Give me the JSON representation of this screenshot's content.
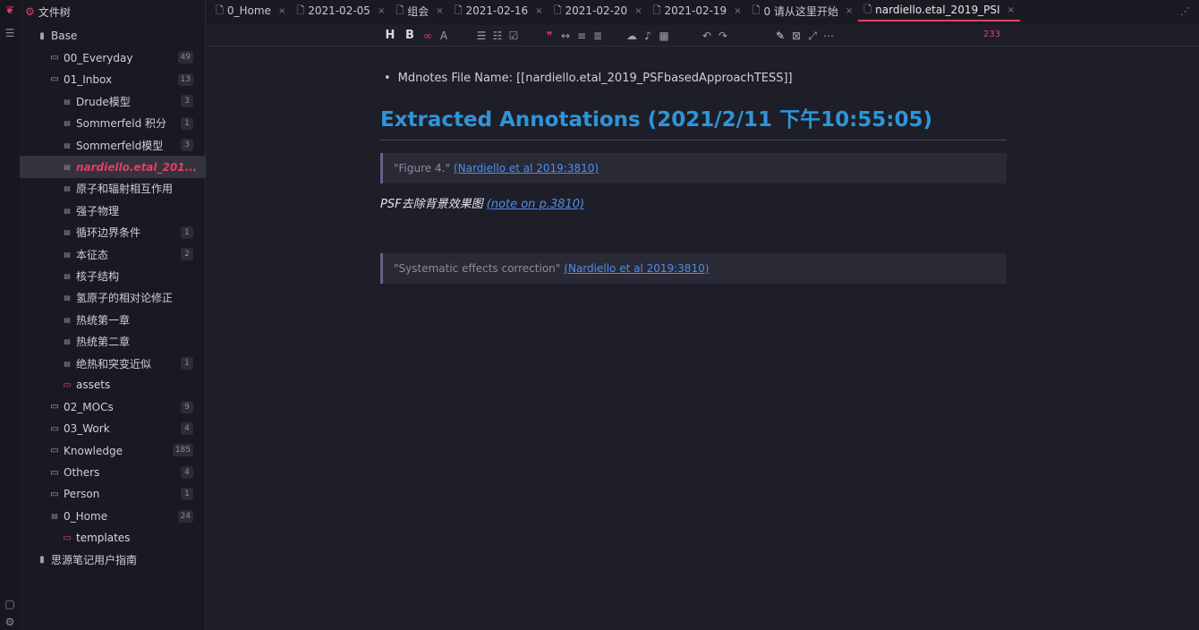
{
  "sidebar": {
    "title": "文件树",
    "items": [
      {
        "label": "Base",
        "icon": "book-icon",
        "count": ""
      },
      {
        "label": "00_Everyday",
        "icon": "folder-icon",
        "count": "49"
      },
      {
        "label": "01_Inbox",
        "icon": "folder-icon",
        "count": "13"
      },
      {
        "label": "Drude模型",
        "icon": "file-icon",
        "count": "3"
      },
      {
        "label": "Sommerfeld 积分",
        "icon": "file-icon",
        "count": "1"
      },
      {
        "label": "Sommerfeld模型",
        "icon": "file-icon",
        "count": "3"
      },
      {
        "label": "nardiello.etal_201...",
        "icon": "file-icon",
        "count": ""
      },
      {
        "label": "原子和辐射相互作用",
        "icon": "file-icon",
        "count": ""
      },
      {
        "label": "强子物理",
        "icon": "file-icon",
        "count": ""
      },
      {
        "label": "循环边界条件",
        "icon": "file-icon",
        "count": "1"
      },
      {
        "label": "本征态",
        "icon": "file-icon",
        "count": "2"
      },
      {
        "label": "核子结构",
        "icon": "file-icon",
        "count": ""
      },
      {
        "label": "氢原子的相对论修正",
        "icon": "file-icon",
        "count": ""
      },
      {
        "label": "热统第一章",
        "icon": "file-icon",
        "count": ""
      },
      {
        "label": "热统第二章",
        "icon": "file-icon",
        "count": ""
      },
      {
        "label": "绝热和突变近似",
        "icon": "file-icon",
        "count": "1"
      },
      {
        "label": "assets",
        "icon": "folder-icon",
        "count": ""
      },
      {
        "label": "02_MOCs",
        "icon": "folder-icon",
        "count": "9"
      },
      {
        "label": "03_Work",
        "icon": "folder-icon",
        "count": "4"
      },
      {
        "label": "Knowledge",
        "icon": "folder-icon",
        "count": "185"
      },
      {
        "label": "Others",
        "icon": "folder-icon",
        "count": "4"
      },
      {
        "label": "Person",
        "icon": "folder-icon",
        "count": "1"
      },
      {
        "label": "0_Home",
        "icon": "file-icon",
        "count": "24"
      },
      {
        "label": "templates",
        "icon": "folder-icon",
        "count": ""
      },
      {
        "label": "思源笔记用户指南",
        "icon": "book-icon",
        "count": ""
      }
    ]
  },
  "tabs": [
    {
      "label": "0_Home"
    },
    {
      "label": "2021-02-05"
    },
    {
      "label": "组会"
    },
    {
      "label": "2021-02-16"
    },
    {
      "label": "2021-02-20"
    },
    {
      "label": "2021-02-19"
    },
    {
      "label": "0 请从这里开始"
    },
    {
      "label": "nardiello.etal_2019_PSI"
    }
  ],
  "toolbar": {
    "heading": "H",
    "bold": "B",
    "word_count": "233"
  },
  "document": {
    "bullet": "Mdnotes File Name: [[nardiello.etal_2019_PSFbasedApproachTESS]]",
    "heading": "Extracted Annotations (2021/2/11 下午10:55:05)",
    "quote1_text": "\"Figure 4.\"",
    "quote1_link": "(Nardiello et al 2019:3810)",
    "note_text": "PSF去除背景效果图 ",
    "note_link": "(note on p.3810)",
    "quote2_text": "\"Systematic effects correction\"",
    "quote2_link": "(Nardiello et al 2019:3810)"
  },
  "colors": {
    "accent": "#e0405f",
    "heading": "#2e95d8",
    "link": "#4d8fe8"
  }
}
